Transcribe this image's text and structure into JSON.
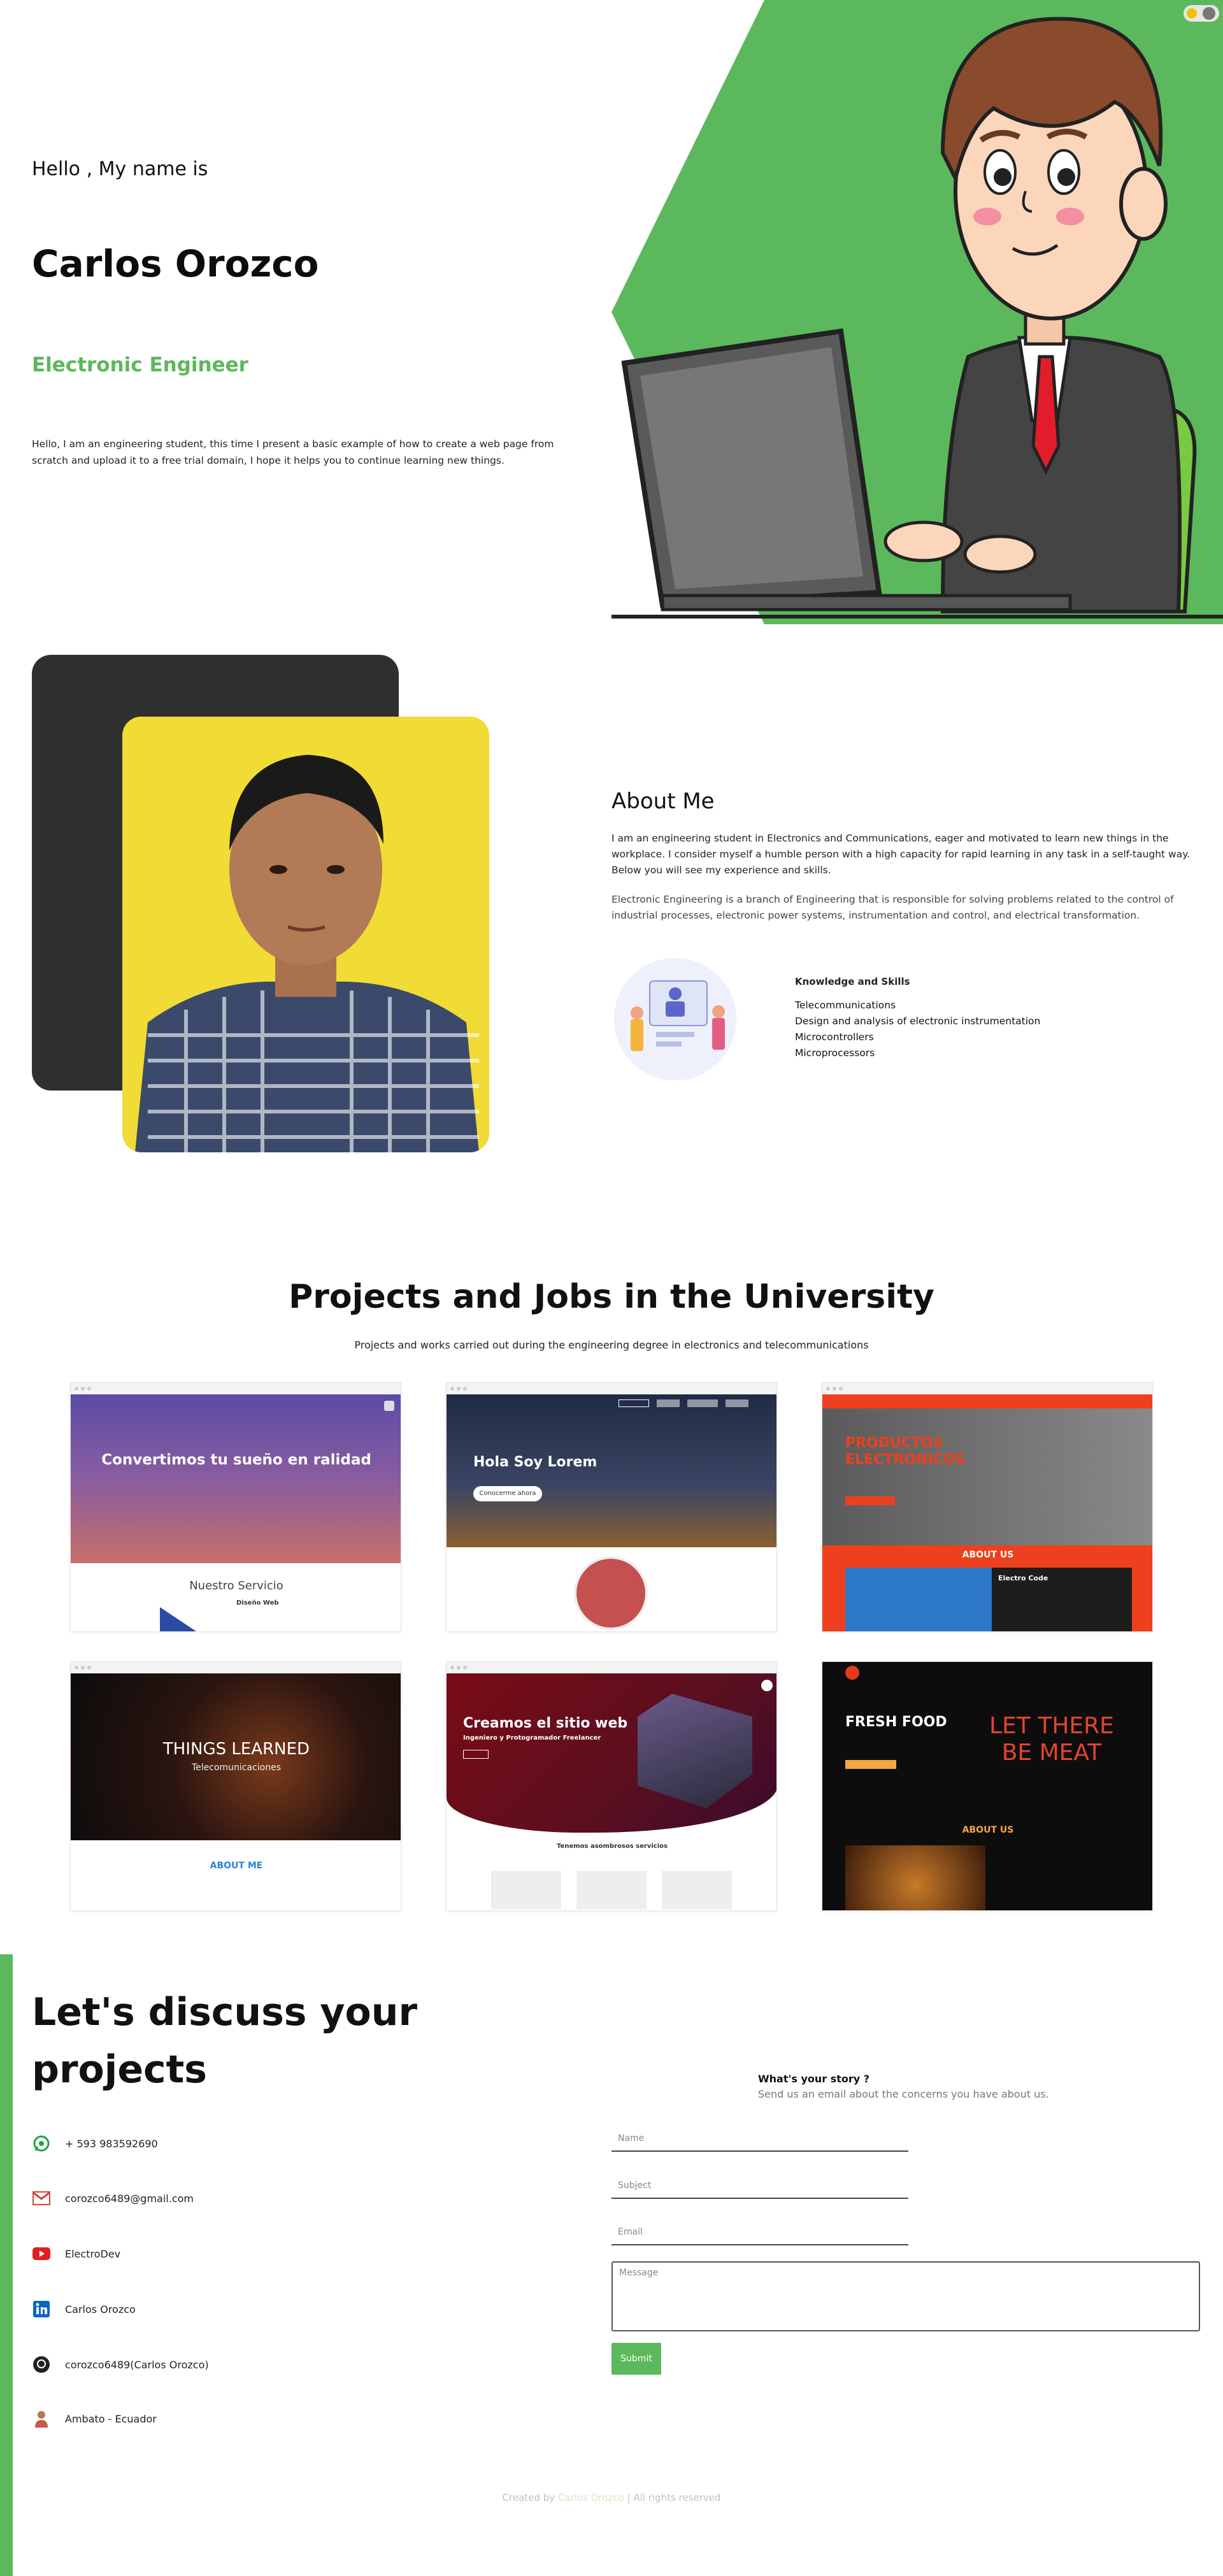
{
  "hero": {
    "greeting": "Hello , My name is",
    "name": "Carlos Orozco",
    "role": "Electronic Engineer",
    "intro": "Hello, I am an engineering student, this time I present a basic example of how to create a web page from scratch and upload it to a free trial domain, I hope it helps you to continue learning new things.",
    "accent_color": "#5cb85c"
  },
  "about": {
    "title": "About Me",
    "paragraph1": "I am an engineering student in Electronics and Communications, eager and motivated to learn new things in the workplace. I consider myself a humble person with a high capacity for rapid learning in any task in a self-taught way. Below you will see my experience and skills.",
    "paragraph2": "Electronic Engineering is a branch of Engineering that is responsible for solving problems related to the control of industrial processes, electronic power systems, instrumentation and control, and electrical transformation.",
    "skills_title": "Knowledge and Skills",
    "skills": [
      "Telecommunications",
      "Design and analysis of electronic instrumentation",
      "Microcontrollers",
      "Microprocessors"
    ]
  },
  "projects": {
    "title": "Projects and Jobs in the University",
    "subtitle": "Projects and works carried out during the engineering degree in electronics and telecommunications",
    "cards": [
      {
        "headline": "Convertimos tu sueño en ralidad",
        "sub": "Nuestro Servicio",
        "extra": "Diseño Web"
      },
      {
        "headline": "Hola Soy Lorem",
        "sub": "Conocerme ahora",
        "extra": ""
      },
      {
        "headline": "PRODUCTOS ELECTRONICOS",
        "sub": "ABOUT US",
        "extra": "Electro Code"
      },
      {
        "headline": "THINGS LEARNED",
        "sub": "Telecomunicaciones",
        "extra": "ABOUT ME"
      },
      {
        "headline": "Creamos el sitio web",
        "sub": "Ingeniero y Protogramador Freelancer",
        "extra": "Tenemos asombrosos servicios"
      },
      {
        "headline": "FRESH FOOD",
        "sub": "ABOUT US",
        "extra": "LET THERE BE MEAT"
      }
    ]
  },
  "contact": {
    "title": "Let's discuss your projects",
    "items": [
      {
        "icon": "whatsapp-icon",
        "label": "+ 593 983592690"
      },
      {
        "icon": "gmail-icon",
        "label": "corozco6489@gmail.com"
      },
      {
        "icon": "youtube-icon",
        "label": "ElectroDev"
      },
      {
        "icon": "linkedin-icon",
        "label": "Carlos Orozco"
      },
      {
        "icon": "github-icon",
        "label": "corozco6489(Carlos Orozco)"
      },
      {
        "icon": "location-avatar-icon",
        "label": "Ambato - Ecuador"
      }
    ],
    "story_title": "What's your story ?",
    "story_sub": "Send us an email about the concerns you have about us.",
    "name_placeholder": "Name",
    "subject_placeholder": "Subject",
    "email_placeholder": "Email",
    "message_placeholder": "Message",
    "submit_label": "Submit"
  },
  "footer": {
    "prefix": "Created by",
    "author": "Carlos Orozco",
    "suffix": "| All rights reserved"
  }
}
